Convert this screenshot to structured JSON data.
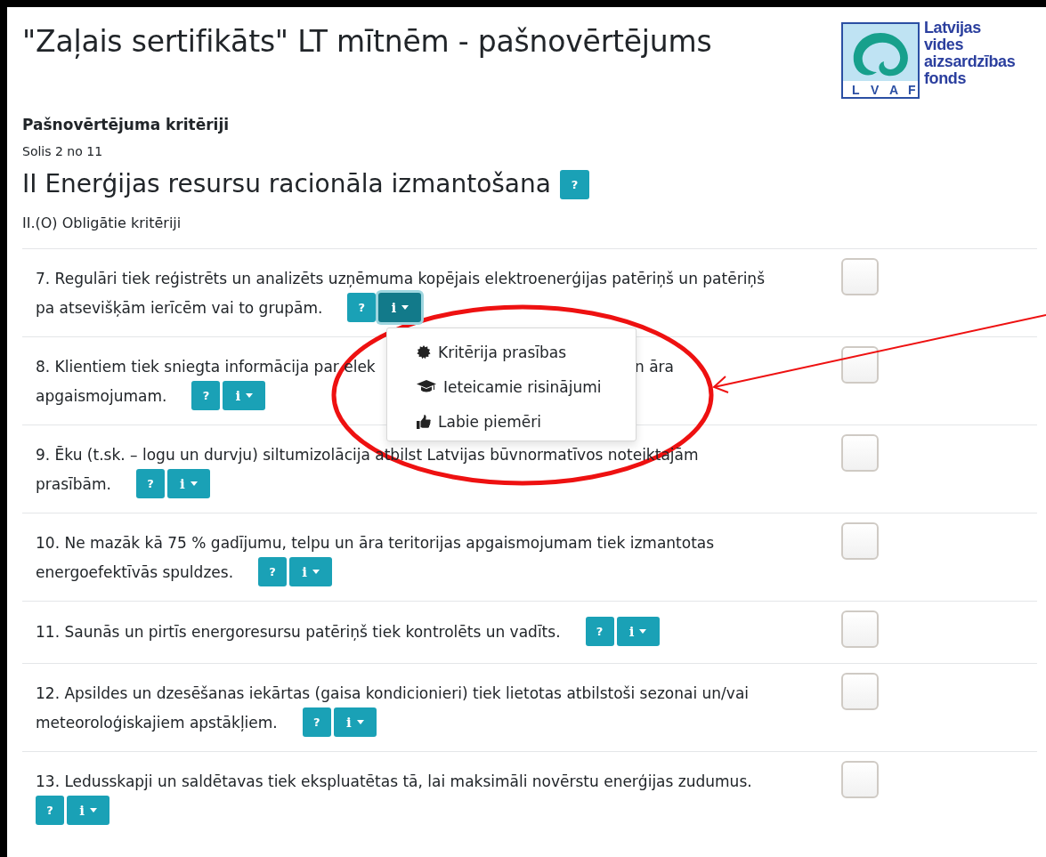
{
  "header": {
    "title": "\"Zaļais sertifikāts\" LT mītnēm - pašnovērtējums",
    "logo": {
      "letters": [
        "L",
        "V",
        "A",
        "F"
      ],
      "lines": [
        "Latvijas",
        "vides",
        "aizsardzības",
        "fonds"
      ]
    }
  },
  "page_heading": "Pašnovērtējuma kritēriji",
  "step": "Solis 2 no 11",
  "section": {
    "title": "II Enerģijas resursu racionāla izmantošana",
    "help_label": "?"
  },
  "subsection": "II.(O) Obligātie kritēriji",
  "criteria": [
    {
      "kind": "lines",
      "lines": [
        "7. Regulāri tiek reģistrēts un analizēts uzņēmuma kopējais elektroenerģijas patēriņš un patēriņš",
        "pa atsevišķām ierīcēm vai to grupām."
      ],
      "help_label": "?",
      "info_label": "i",
      "expanded": true,
      "checked": false
    },
    {
      "kind": "split",
      "parts": [
        "8. Klientiem tiek sniegta informācija par elek",
        "n āra",
        "apgaismojumam."
      ],
      "help_label": "?",
      "info_label": "i",
      "expanded": false,
      "checked": false
    },
    {
      "kind": "lines",
      "lines": [
        "9. Ēku (t.sk. – logu un durvju) siltumizolācija atbilst Latvijas būvnormatīvos noteiktajām",
        "prasībām."
      ],
      "help_label": "?",
      "info_label": "i",
      "expanded": false,
      "checked": false
    },
    {
      "kind": "lines",
      "lines": [
        "10. Ne mazāk kā 75 % gadījumu, telpu un āra teritorijas apgaismojumam tiek izmantotas",
        "energoefektīvās spuldzes."
      ],
      "help_label": "?",
      "info_label": "i",
      "expanded": false,
      "checked": false
    },
    {
      "kind": "lines",
      "lines": [
        "11. Saunās un pirtīs energoresursu patēriņš tiek kontrolēts un vadīts."
      ],
      "help_label": "?",
      "info_label": "i",
      "expanded": false,
      "checked": false
    },
    {
      "kind": "lines",
      "lines": [
        "12. Apsildes un dzesēšanas iekārtas (gaisa kondicionieri) tiek lietotas atbilstoši sezonai un/vai",
        "meteoroloģiskajiem apstākļiem."
      ],
      "help_label": "?",
      "info_label": "i",
      "expanded": false,
      "checked": false
    },
    {
      "kind": "lines",
      "lines": [
        "13. Ledusskapji un saldētavas tiek ekspluatētas tā, lai maksimāli novērstu enerģijas zudumus."
      ],
      "help_label": "?",
      "info_label": "i",
      "expanded": false,
      "checked": false
    }
  ],
  "dropdown": {
    "items": [
      {
        "kind": "seal",
        "label": "Kritērija prasības"
      },
      {
        "kind": "cap",
        "label": "Ieteicamie risinājumi"
      },
      {
        "kind": "thumb",
        "label": "Labie piemēri"
      }
    ]
  }
}
